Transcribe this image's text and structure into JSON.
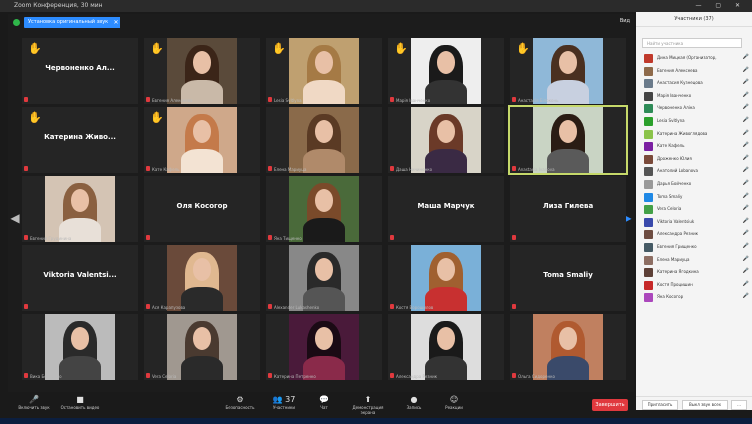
{
  "window": {
    "title": "Zoom Конференция, 30 мин",
    "controls": "— ▢ ✕"
  },
  "meeting": {
    "label": "Установка оригинальный звук",
    "close": "✕",
    "view": "Вид"
  },
  "nav": {
    "left": "◀",
    "right": "▶",
    "left_page": "1/2",
    "right_page": "1/2"
  },
  "tiles": [
    {
      "name": "Чеpвоненко Ал...",
      "type": "name",
      "hand": true
    },
    {
      "name": "Евгения Алексеева",
      "type": "video",
      "hand": true,
      "colors": [
        "#5a4a3a",
        "#3b2518",
        "#c9b9a8"
      ]
    },
    {
      "name": "Lesia Svitlyna",
      "type": "video",
      "hand": true,
      "colors": [
        "#bfa070",
        "#a57a45",
        "#f0d9c5"
      ]
    },
    {
      "name": "Марія Іванченко",
      "type": "video",
      "hand": true,
      "colors": [
        "#eeeeee",
        "#1a1a1a",
        "#333333"
      ]
    },
    {
      "name": "Анастасія Білоконь",
      "type": "video",
      "hand": true,
      "colors": [
        "#8fb8d8",
        "#4a3020",
        "#c8d0e0"
      ]
    },
    {
      "name": "Катерина Живо...",
      "type": "name",
      "hand": true
    },
    {
      "name": "Кате Кафель",
      "type": "video",
      "hand": true,
      "colors": [
        "#cfa88a",
        "#c47a4a",
        "#f3e3d3"
      ]
    },
    {
      "name": "Елена Мариуца",
      "type": "video",
      "hand": false,
      "colors": [
        "#8a6a4a",
        "#5a3a24",
        "#b08a6a"
      ]
    },
    {
      "name": "Даша Ничиненко",
      "type": "video",
      "hand": false,
      "colors": [
        "#d8d4c8",
        "#6b3a28",
        "#3a2a44"
      ]
    },
    {
      "name": "Anastasia Ivanova",
      "type": "video",
      "hand": false,
      "colors": [
        "#c9d4c4",
        "#2a1c14",
        "#5a5a5a"
      ],
      "active": true
    },
    {
      "name": "Евгения Грудинина",
      "type": "video",
      "hand": false,
      "colors": [
        "#d4c4b4",
        "#8a6040",
        "#e8e0d8"
      ]
    },
    {
      "name": "Оля Косогор",
      "type": "name",
      "hand": false
    },
    {
      "name": "Яна Тищенко",
      "type": "video",
      "hand": false,
      "colors": [
        "#4a6a3a",
        "#7a4a2a",
        "#1a1a1a"
      ]
    },
    {
      "name": "Маша Марчук",
      "type": "name",
      "hand": false
    },
    {
      "name": "Лиза Гилева",
      "type": "name",
      "hand": false
    },
    {
      "name": "Viktoria Valentsi...",
      "type": "name",
      "hand": false
    },
    {
      "name": "Ася Карапузова",
      "type": "video",
      "hand": false,
      "colors": [
        "#6a4a3a",
        "#e0b890",
        "#2a2a2a"
      ]
    },
    {
      "name": "Alexander Lukashenko",
      "type": "video",
      "hand": false,
      "colors": [
        "#888888",
        "#2a2a2a",
        "#555555"
      ]
    },
    {
      "name": "Костя Ворошилов",
      "type": "video",
      "hand": false,
      "colors": [
        "#7ab0d8",
        "#a06030",
        "#c83030"
      ]
    },
    {
      "name": "Toma Smaliy",
      "type": "name",
      "hand": false
    },
    {
      "name": "Вика Бойченко",
      "type": "video",
      "hand": false,
      "colors": [
        "#bbbbbb",
        "#2a2a2a",
        "#444444"
      ]
    },
    {
      "name": "Vera Celoria",
      "type": "video",
      "hand": false,
      "colors": [
        "#a09890",
        "#4a3a30",
        "#2a2a2a"
      ]
    },
    {
      "name": "Катерина Петренко",
      "type": "video",
      "hand": false,
      "colors": [
        "#4a1a3a",
        "#1a0a14",
        "#8a2a4a"
      ]
    },
    {
      "name": "Александра Резник",
      "type": "video",
      "hand": false,
      "colors": [
        "#dddddd",
        "#1a1a1a",
        "#333333"
      ]
    },
    {
      "name": "Ольга Сидоренко",
      "type": "video",
      "hand": false,
      "colors": [
        "#c08060",
        "#b05a30",
        "#3a4a6a"
      ]
    }
  ],
  "toolbar": {
    "buttons": [
      {
        "icon": "🎤",
        "label": "Включить звук"
      },
      {
        "icon": "■",
        "label": "Остановить видео"
      },
      {
        "icon": "⚙",
        "label": "Безопасность"
      },
      {
        "icon": "👥 37",
        "label": "Участники"
      },
      {
        "icon": "💬",
        "label": "Чат"
      },
      {
        "icon": "⬆",
        "label": "Демонстрация экрана"
      },
      {
        "icon": "●",
        "label": "Запись"
      },
      {
        "icon": "☺",
        "label": "Реакции"
      }
    ],
    "end": "Завершить"
  },
  "panel": {
    "title": "Участники (37)",
    "search": "Найти участника",
    "participants": [
      {
        "name": "Дина Мицкая (Организатор, я)",
        "color": "#c0392b"
      },
      {
        "name": "Евгения Алексеева",
        "color": "#8e6a4a"
      },
      {
        "name": "Анастасия Кузнецова",
        "color": "#6a7a8a"
      },
      {
        "name": "Марія Іванченко",
        "color": "#444444"
      },
      {
        "name": "Червоненко Аліна",
        "color": "#2e8b57"
      },
      {
        "name": "Lesia Svitlyna",
        "color": "#2ca02c"
      },
      {
        "name": "Катерина Живоглядова",
        "color": "#8bc34a"
      },
      {
        "name": "Кате Кафель",
        "color": "#7b1fa2"
      },
      {
        "name": "Дроженко Юлия",
        "color": "#7a4a3a"
      },
      {
        "name": "Анатолий Lobanova",
        "color": "#555555"
      },
      {
        "name": "Дарья Бойченко",
        "color": "#999999"
      },
      {
        "name": "Toma Smaliy",
        "color": "#1e88e5"
      },
      {
        "name": "Vera Celoria",
        "color": "#43a047"
      },
      {
        "name": "Viktoria Valentsiuk",
        "color": "#3949ab"
      },
      {
        "name": "Александра Резник",
        "color": "#6d4c41"
      },
      {
        "name": "Евгения Грищенко",
        "color": "#455a64"
      },
      {
        "name": "Елена Мариуца",
        "color": "#8d6e63"
      },
      {
        "name": "Катерина Ягодкина",
        "color": "#5d4037"
      },
      {
        "name": "Костя Процишин",
        "color": "#c62828"
      },
      {
        "name": "Яна Косогор",
        "color": "#ab47bc"
      }
    ],
    "invite": "Пригласить",
    "mute_all": "Выкл звук всех",
    "more": "..."
  }
}
